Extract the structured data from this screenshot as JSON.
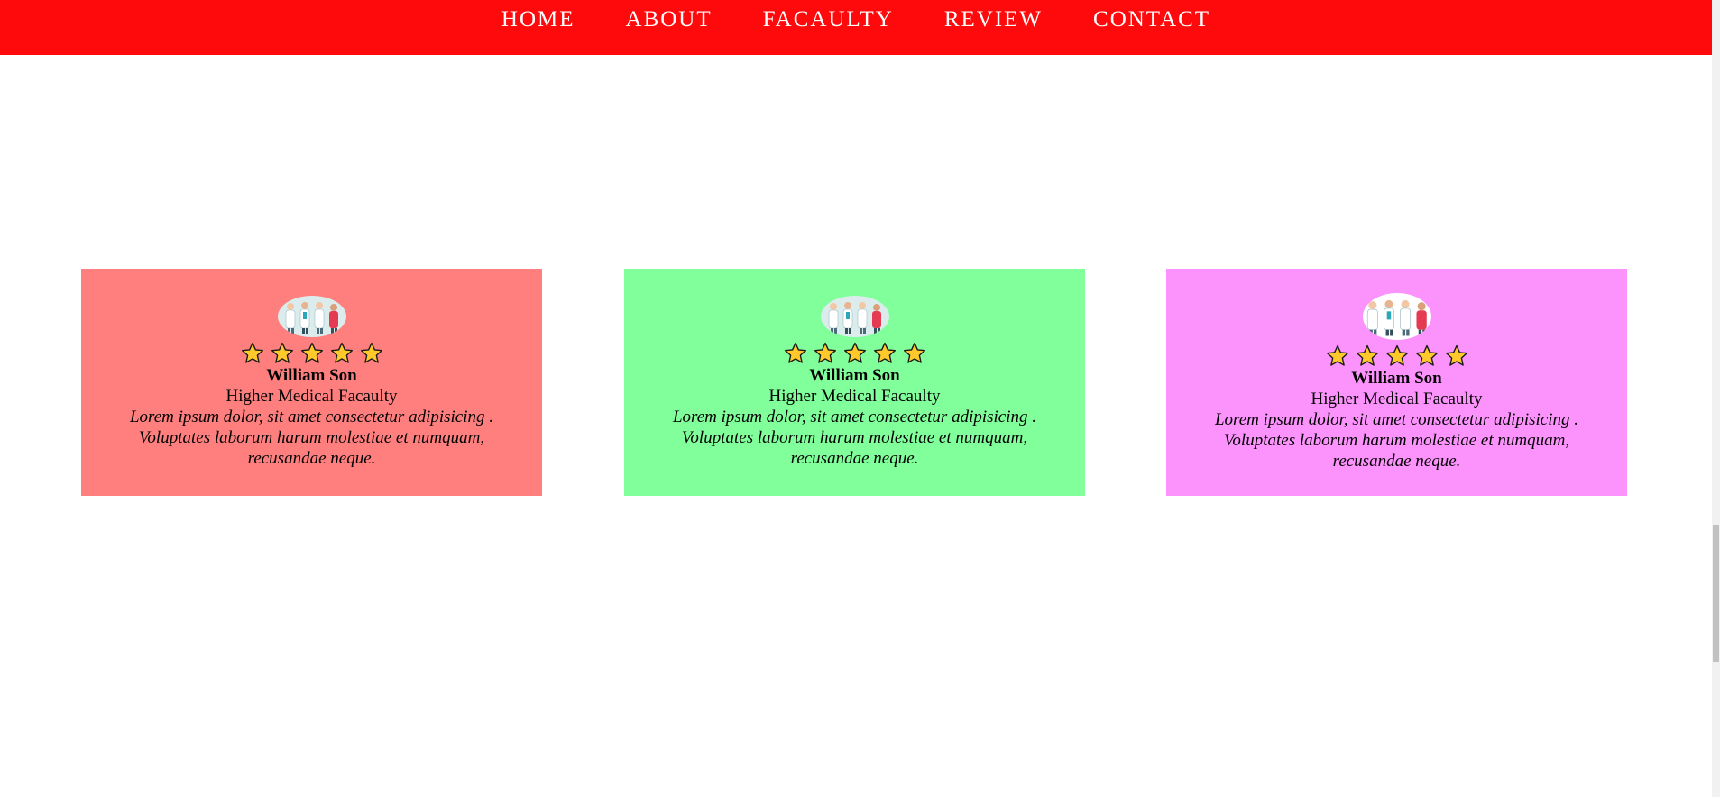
{
  "nav": {
    "items": [
      {
        "label": "HOME"
      },
      {
        "label": "ABOUT"
      },
      {
        "label": "FACAULTY"
      },
      {
        "label": "REVIEW"
      },
      {
        "label": "CONTACT"
      }
    ]
  },
  "colors": {
    "nav_background": "#ff0a0c",
    "card_1": "#ff7f7f",
    "card_2": "#80ff9a",
    "card_3": "#fc93fc",
    "star_fill": "#ffc92c"
  },
  "reviews": [
    {
      "stars": 5,
      "name": "William Son",
      "role": "Higher Medical Facaulty",
      "text": "Lorem ipsum dolor, sit amet consectetur adipisicing . Voluptates laborum harum molestiae et numquam, recusandae neque."
    },
    {
      "stars": 5,
      "name": "William Son",
      "role": "Higher Medical Facaulty",
      "text": "Lorem ipsum dolor, sit amet consectetur adipisicing . Voluptates laborum harum molestiae et numquam, recusandae neque."
    },
    {
      "stars": 5,
      "name": "William Son",
      "role": "Higher Medical Facaulty",
      "text": "Lorem ipsum dolor, sit amet consectetur adipisicing . Voluptates laborum harum molestiae et numquam, recusandae neque."
    }
  ]
}
